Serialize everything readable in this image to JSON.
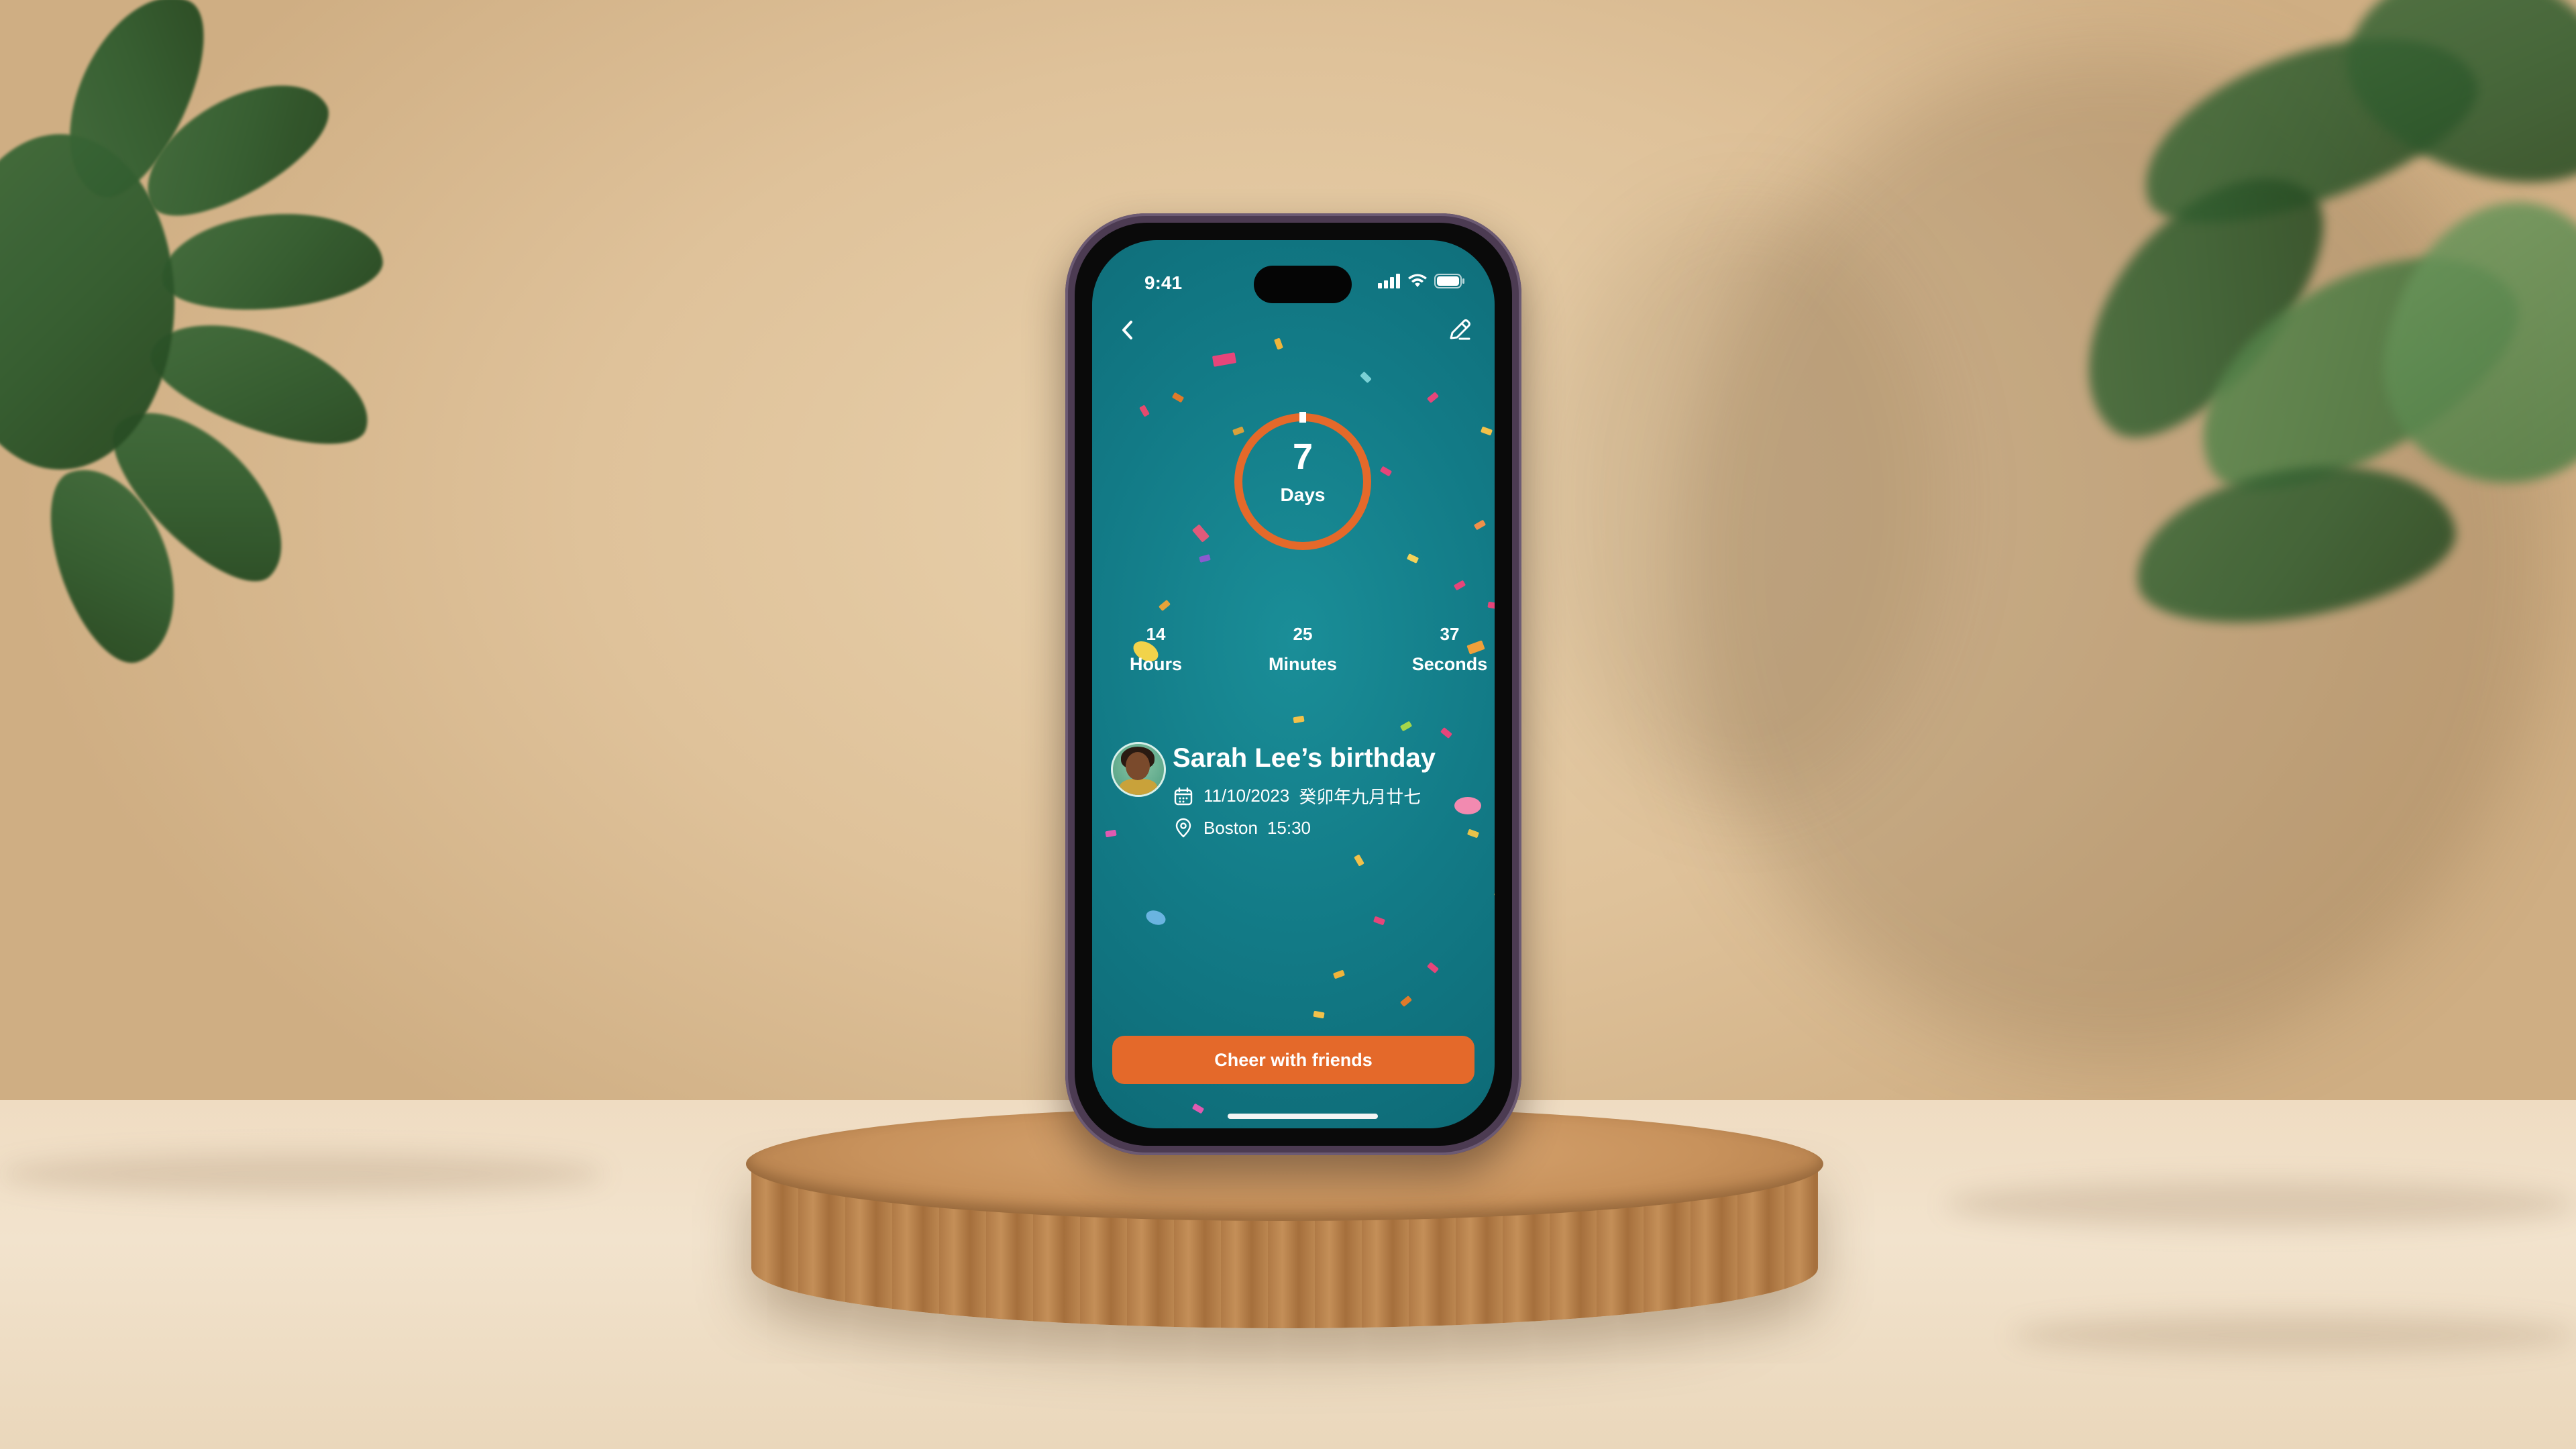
{
  "status_bar": {
    "time": "9:41"
  },
  "countdown": {
    "days_value": "7",
    "days_label": "Days",
    "ring_color": "#E4692A",
    "items": [
      {
        "value": "14",
        "label": "Hours"
      },
      {
        "value": "25",
        "label": "Minutes"
      },
      {
        "value": "37",
        "label": "Seconds"
      }
    ]
  },
  "event": {
    "title": "Sarah Lee’s birthday",
    "date": "11/10/2023",
    "lunar_date": "癸卯年九月廿七",
    "location": "Boston",
    "time": "15:30"
  },
  "cta": {
    "label": "Cheer with friends",
    "color": "#E4692A"
  },
  "icons": {
    "nav_back": "chevron-left-icon",
    "nav_edit": "pencil-icon",
    "date": "calendar-icon",
    "location": "location-pin-icon"
  },
  "theme": {
    "screen_bg": "#127A86",
    "accent": "#E4692A"
  }
}
